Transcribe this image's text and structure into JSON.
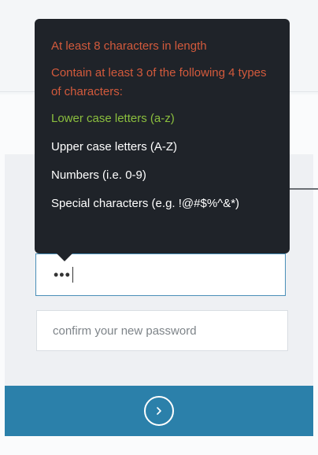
{
  "tooltip": {
    "requirements": [
      {
        "text": "At least 8 characters in length",
        "status": "unmet",
        "color": "#d35a3c"
      },
      {
        "text": "Contain at least 3 of the following 4 types of characters:",
        "status": "unmet",
        "color": "#d35a3c"
      },
      {
        "text": "Lower case letters (a-z)",
        "status": "met",
        "color": "#8bbf3e"
      },
      {
        "text": "Upper case letters (A-Z)",
        "status": "neutral",
        "color": "#ffffff"
      },
      {
        "text": "Numbers (i.e. 0-9)",
        "status": "neutral",
        "color": "#ffffff"
      },
      {
        "text": "Special characters (e.g. !@#$%^&*)",
        "status": "neutral",
        "color": "#ffffff"
      }
    ]
  },
  "form": {
    "new_password_value": "•••",
    "confirm_password_placeholder": "confirm your new password"
  },
  "submit": {
    "icon": "chevron-right-icon",
    "color": "#2b80aa"
  }
}
